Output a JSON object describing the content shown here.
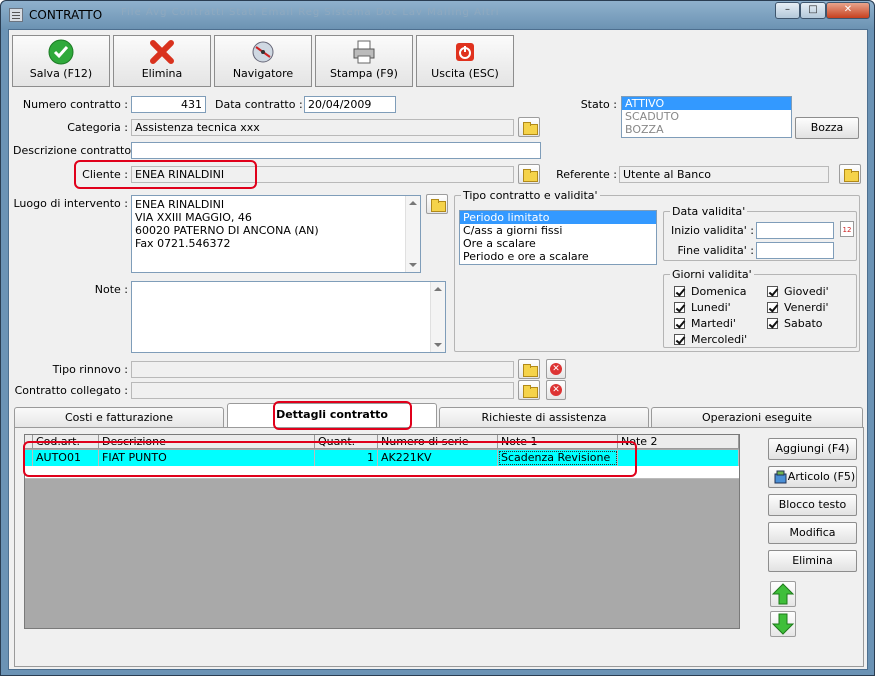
{
  "window": {
    "title": "CONTRATTO",
    "menu_ghost": "File  Avg  Contratti  Stati  Email  Reg  Sistema  Doc  Lav  Mailing  Altri"
  },
  "toolbar": {
    "save": "Salva (F12)",
    "delete": "Elimina",
    "navigator": "Navigatore",
    "print": "Stampa (F9)",
    "exit": "Uscita (ESC)"
  },
  "form": {
    "numero_label": "Numero contratto :",
    "numero_value": "431",
    "data_label": "Data contratto :",
    "data_value": "20/04/2009",
    "stato_label": "Stato :",
    "stato_options": [
      "ATTIVO",
      "SCADUTO",
      "BOZZA"
    ],
    "bozza_button": "Bozza",
    "categoria_label": "Categoria :",
    "categoria_value": "Assistenza tecnica xxx",
    "descrizione_label": "Descrizione contratto :",
    "descrizione_value": "",
    "cliente_label": "Cliente :",
    "cliente_value": "ENEA RINALDINI",
    "referente_label": "Referente :",
    "referente_value": "Utente al Banco",
    "luogo_label": "Luogo di intervento :",
    "luogo_lines": [
      "ENEA RINALDINI",
      "VIA XXIII MAGGIO, 46",
      "60020 PATERNO DI ANCONA (AN)",
      "Fax 0721.546372"
    ],
    "note_label": "Note :",
    "tipo_rinnovo_label": "Tipo rinnovo :",
    "contratto_collegato_label": "Contratto collegato :"
  },
  "tipo_validita": {
    "caption": "Tipo contratto e validita'",
    "options": [
      "Periodo limitato",
      "C/ass a giorni fissi",
      "Ore a scalare",
      "Periodo e ore a scalare"
    ],
    "data_caption": "Data validita'",
    "inizio_label": "Inizio validita' :",
    "fine_label": "Fine validita' :",
    "calendar_day": "12",
    "giorni_caption": "Giorni validita'",
    "giorni_left": [
      "Domenica",
      "Lunedi'",
      "Martedi'",
      "Mercoledi'"
    ],
    "giorni_right": [
      "Giovedi'",
      "Venerdi'",
      "Sabato"
    ]
  },
  "tabs": [
    "Costi e fatturazione",
    "Dettagli contratto",
    "Richieste di assistenza",
    "Operazioni eseguite"
  ],
  "grid": {
    "headers": [
      "Cod.art.",
      "Descrizione",
      "Quant.",
      "Numero di serie",
      "Note 1",
      "Note 2"
    ],
    "row": [
      "AUTO01",
      "FIAT PUNTO",
      "1",
      "AK221KV",
      "Scadenza Revisione",
      ""
    ]
  },
  "side_buttons": {
    "aggiungi": "Aggiungi (F4)",
    "articolo": "Articolo (F5)",
    "blocco": "Blocco testo",
    "modifica": "Modifica",
    "elimina": "Elimina"
  },
  "colors": {
    "selection": "#3399ff",
    "grid_row": "#00ffff",
    "highlight": "#e0001b"
  }
}
